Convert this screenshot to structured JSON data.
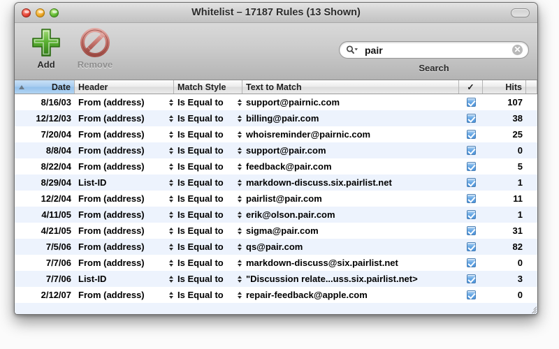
{
  "window": {
    "title": "Whitelist – 17187 Rules (13 Shown)",
    "traffic_lights": [
      "close-button",
      "minimize-button",
      "zoom-button"
    ],
    "toolbar_toggle": "toolbar-toggle-button"
  },
  "toolbar": {
    "add_label": "Add",
    "add_icon": "green-plus-icon",
    "remove_label": "Remove",
    "remove_icon": "red-prohibition-icon",
    "remove_enabled": false,
    "search": {
      "value": "pair",
      "placeholder": "",
      "label": "Search",
      "magnifier_icon": "search-magnifier-icon",
      "clear_icon": "clear-text-icon",
      "clear_glyph": "✕"
    }
  },
  "table": {
    "columns": [
      {
        "key": "date",
        "label": "Date",
        "align": "right",
        "sorted": true,
        "sort_dir": "ascending"
      },
      {
        "key": "header",
        "label": "Header",
        "align": "left",
        "sorted": false
      },
      {
        "key": "match",
        "label": "Match Style",
        "align": "left",
        "sorted": false
      },
      {
        "key": "text",
        "label": "Text to Match",
        "align": "left",
        "sorted": false
      },
      {
        "key": "check",
        "label": "✓",
        "align": "center",
        "sorted": false
      },
      {
        "key": "hits",
        "label": "Hits",
        "align": "right",
        "sorted": false
      }
    ],
    "rows": [
      {
        "date": "8/16/03",
        "header": "From (address)",
        "match": "Is Equal to",
        "text": "support@pairnic.com",
        "checked": true,
        "hits": "107"
      },
      {
        "date": "12/12/03",
        "header": "From (address)",
        "match": "Is Equal to",
        "text": "billing@pair.com",
        "checked": true,
        "hits": "38"
      },
      {
        "date": "7/20/04",
        "header": "From (address)",
        "match": "Is Equal to",
        "text": "whoisreminder@pairnic.com",
        "checked": true,
        "hits": "25"
      },
      {
        "date": "8/8/04",
        "header": "From (address)",
        "match": "Is Equal to",
        "text": "support@pair.com",
        "checked": true,
        "hits": "0"
      },
      {
        "date": "8/22/04",
        "header": "From (address)",
        "match": "Is Equal to",
        "text": "feedback@pair.com",
        "checked": true,
        "hits": "5"
      },
      {
        "date": "8/29/04",
        "header": "List-ID",
        "match": "Is Equal to",
        "text": "markdown-discuss.six.pairlist.net",
        "checked": true,
        "hits": "1"
      },
      {
        "date": "12/2/04",
        "header": "From (address)",
        "match": "Is Equal to",
        "text": "pairlist@pair.com",
        "checked": true,
        "hits": "11"
      },
      {
        "date": "4/11/05",
        "header": "From (address)",
        "match": "Is Equal to",
        "text": "erik@olson.pair.com",
        "checked": true,
        "hits": "1"
      },
      {
        "date": "4/21/05",
        "header": "From (address)",
        "match": "Is Equal to",
        "text": "sigma@pair.com",
        "checked": true,
        "hits": "31"
      },
      {
        "date": "7/5/06",
        "header": "From (address)",
        "match": "Is Equal to",
        "text": "qs@pair.com",
        "checked": true,
        "hits": "82"
      },
      {
        "date": "7/7/06",
        "header": "From (address)",
        "match": "Is Equal to",
        "text": "markdown-discuss@six.pairlist.net",
        "checked": true,
        "hits": "0"
      },
      {
        "date": "7/7/06",
        "header": "List-ID",
        "match": "Is Equal to",
        "text": "\"Discussion relate...uss.six.pairlist.net>",
        "checked": true,
        "hits": "3"
      },
      {
        "date": "2/12/07",
        "header": "From (address)",
        "match": "Is Equal to",
        "text": "repair-feedback@apple.com",
        "checked": true,
        "hits": "0"
      }
    ],
    "empty_rows": 2
  },
  "colors": {
    "stripe": "#edf3fd",
    "sorted_header": "#a8cdf0",
    "checkbox": "#4d93da",
    "add_icon": "#4fa22a",
    "remove_icon": "#c05a52"
  }
}
